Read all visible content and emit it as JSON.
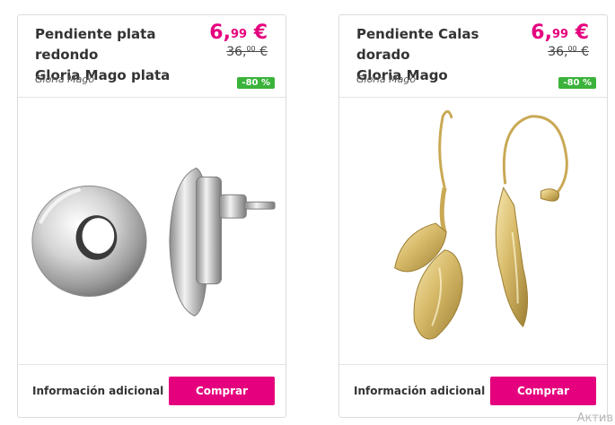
{
  "products": [
    {
      "title_line1": "Pendiente plata redondo",
      "title_line2": "Gloria Mago plata",
      "price_main": "6,",
      "price_cents": "99",
      "price_currency": " €",
      "old_price_main": "36,",
      "old_price_cents": "00",
      "old_price_currency": " €",
      "brand": "Gloria Mago",
      "discount": "-80 %",
      "info_label": "Información adicional",
      "buy_label": "Comprar",
      "image": "silver-round-earring"
    },
    {
      "title_line1": "Pendiente Calas dorado",
      "title_line2": "Gloria Mago",
      "price_main": "6,",
      "price_cents": "99",
      "price_currency": " €",
      "old_price_main": "36,",
      "old_price_cents": "00",
      "old_price_currency": " €",
      "brand": "Gloria Mago",
      "discount": "-80 %",
      "info_label": "Información adicional",
      "buy_label": "Comprar",
      "image": "gold-calla-lily-earring"
    }
  ],
  "watermark": "Актив",
  "colors": {
    "accent": "#e5007e",
    "badge": "#3bb33b",
    "border": "#dcdcdc"
  }
}
